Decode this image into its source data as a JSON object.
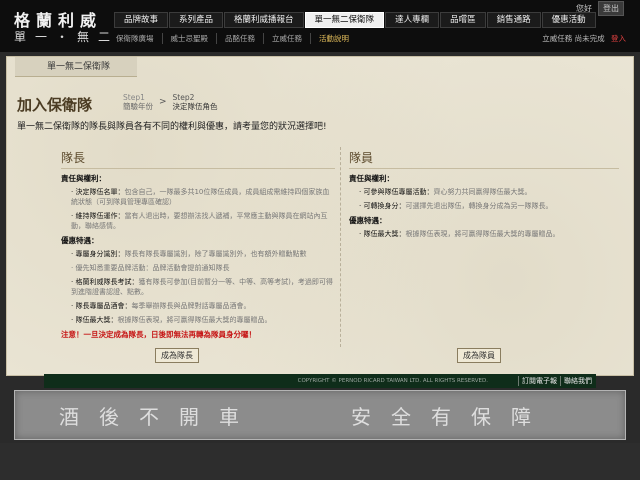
{
  "header": {
    "logo_title": "格蘭利威",
    "logo_sub": "單一・無二",
    "top_links": {
      "hello": "您好",
      "logout": "登出"
    },
    "nav": [
      {
        "label": "品牌故事"
      },
      {
        "label": "系列產品"
      },
      {
        "label": "格蘭利威播報台"
      },
      {
        "label": "單一無二保衛隊"
      },
      {
        "label": "達人專欄"
      },
      {
        "label": "品嚐區"
      },
      {
        "label": "銷售通路"
      },
      {
        "label": "優惠活動"
      }
    ],
    "active_nav": "單一無二保衛隊",
    "sub_nav": [
      {
        "label": "保衛隊廣場"
      },
      {
        "label": "威士忌聖殿"
      },
      {
        "label": "品酩任務"
      },
      {
        "label": "立威任務"
      },
      {
        "label": "活動說明"
      }
    ],
    "sub_status": {
      "text": "立威任務 尚未完成",
      "login": "登入"
    }
  },
  "main": {
    "section_tab": "單一無二保衛隊",
    "title": "加入保衛隊",
    "steps": [
      {
        "step": "Step1",
        "label": "簡驗年份"
      },
      {
        "step": "Step2",
        "label": "決定隊伍角色"
      }
    ],
    "arrow": ">",
    "intro": "單一無二保衛隊的隊長與隊員各有不同的權利與優惠，請考量您的狀況選擇吧!",
    "captain": {
      "title": "隊長",
      "rights_heading": "責任與權利：",
      "rights": [
        {
          "label": "‧ 決定隊伍名單：",
          "desc": "包含自己，一隊最多共10位隊伍成員，成員組成需維持四個家族血統狀態（可到隊員管理專區確認）"
        },
        {
          "label": "‧ 維持隊伍運作：",
          "desc": "當有人退出時，要想辦法找人遞補，平常應主動與隊員在網站內互動，聯絡感情。"
        }
      ],
      "benefits_heading": "優惠特遇：",
      "benefits": [
        {
          "label": "‧ 專屬身分識別：",
          "desc": "隊長有隊長專屬識別，除了專屬識別外，也有額外贈勳點數"
        },
        {
          "label": "",
          "desc": "‧ 優先知悉重要品牌活動：品牌活動會提前通知隊長"
        },
        {
          "label": "‧ 格蘭利威隊長考試：",
          "desc": "獲有隊長可參加(目前暫分一等、中等、高等考試)，考過即可得到進階證書認證、點數。"
        },
        {
          "label": "‧ 隊長專屬品酒會：",
          "desc": "每季舉辦隊長與品牌對話專屬品酒會。"
        },
        {
          "label": "‧ 隊伍最大獎：",
          "desc": "根據隊伍表現，將可贏得隊伍最大獎的專屬贈品。"
        }
      ],
      "note": "注意！一旦決定成為隊長，日後即無法再轉為隊員身分囉！",
      "button": "成為隊長"
    },
    "member": {
      "title": "隊員",
      "rights_heading": "責任與權利：",
      "rights": [
        {
          "label": "‧ 可參與隊伍專屬活動：",
          "desc": "齊心努力共同贏得隊伍最大獎。"
        },
        {
          "label": "‧ 可轉換身分：",
          "desc": "可選擇先退出隊伍，轉換身分成為另一隊隊長。"
        }
      ],
      "benefits_heading": "優惠特遇：",
      "benefits": [
        {
          "label": "‧ 隊伍最大獎：",
          "desc": "根據隊伍表現，將可贏得隊伍最大獎的專屬贈品。"
        }
      ],
      "button": "成為隊員"
    }
  },
  "footer": {
    "copyright": "COPYRIGHT © PERNOD RICARD TAIWAN LTD. ALL RIGHTS RESERVED.",
    "links": [
      "訂閱電子報",
      "聯絡我們"
    ]
  },
  "banner": {
    "left": "酒後不開車",
    "right": "安全有保障"
  }
}
